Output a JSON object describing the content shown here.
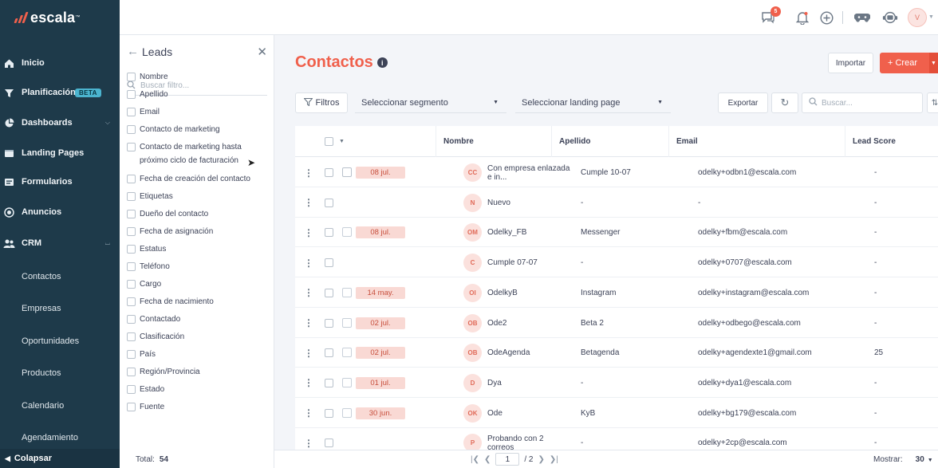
{
  "brand": {
    "name": "escala",
    "accent": "#f0604c",
    "sidebar_bg": "#1e3a4a"
  },
  "sidebar": {
    "items": [
      {
        "label": "Inicio",
        "icon": "home-icon"
      },
      {
        "label": "Planificación",
        "icon": "funnel-icon",
        "badge": "BETA"
      },
      {
        "label": "Dashboards",
        "icon": "pie-chart-icon",
        "chevron": "down"
      },
      {
        "label": "Landing Pages",
        "icon": "browser-icon"
      },
      {
        "label": "Formularios",
        "icon": "form-icon"
      },
      {
        "label": "Anuncios",
        "icon": "target-icon"
      },
      {
        "label": "CRM",
        "icon": "users-icon",
        "chevron": "up"
      }
    ],
    "crm_sub": [
      "Contactos",
      "Empresas",
      "Oportunidades",
      "Productos",
      "Calendario",
      "Agendamiento"
    ],
    "collapse_label": "Colapsar"
  },
  "topbar": {
    "notifications_count": "5",
    "avatar_initial": "V"
  },
  "filter_panel": {
    "title": "Leads",
    "search_placeholder": "Buscar filtro...",
    "fields": [
      "Nombre",
      "Apellido",
      "Email",
      "Contacto de marketing",
      "Contacto de marketing hasta próximo ciclo de facturación",
      "Fecha de creación del contacto",
      "Etiquetas",
      "Dueño del contacto",
      "Fecha de asignación",
      "Estatus",
      "Teléfono",
      "Cargo",
      "Fecha de nacimiento",
      "Contactado",
      "Clasificación",
      "País",
      "Región/Provincia",
      "Estado",
      "Fuente"
    ]
  },
  "main": {
    "title": "Contactos",
    "import_label": "Importar",
    "create_label": "+ Crear",
    "filters_label": "Filtros",
    "segment_placeholder": "Seleccionar segmento",
    "landing_placeholder": "Seleccionar landing page",
    "export_label": "Exportar",
    "search_placeholder": "Buscar..."
  },
  "table": {
    "columns": [
      "Nombre",
      "Apellido",
      "Email",
      "Lead Score"
    ],
    "rows": [
      {
        "date": "08 jul.",
        "initials": "CC",
        "name": "Con empresa enlazada e in...",
        "apellido": "Cumple 10-07",
        "email": "odelky+odbn1@escala.com",
        "score": "-"
      },
      {
        "date": "",
        "initials": "N",
        "name": "Nuevo",
        "apellido": "-",
        "email": "-",
        "score": "-"
      },
      {
        "date": "08 jul.",
        "initials": "OM",
        "name": "Odelky_FB",
        "apellido": "Messenger",
        "email": "odelky+fbm@escala.com",
        "score": "-"
      },
      {
        "date": "",
        "initials": "C",
        "name": "Cumple 07-07",
        "apellido": "-",
        "email": "odelky+0707@escala.com",
        "score": "-"
      },
      {
        "date": "14 may.",
        "initials": "OI",
        "name": "OdelkyB",
        "apellido": "Instagram",
        "email": "odelky+instagram@escala.com",
        "score": "-"
      },
      {
        "date": "02 jul.",
        "initials": "OB",
        "name": "Ode2",
        "apellido": "Beta 2",
        "email": "odelky+odbego@escala.com",
        "score": "-"
      },
      {
        "date": "02 jul.",
        "initials": "OB",
        "name": "OdeAgenda",
        "apellido": "Betagenda",
        "email": "odelky+agendexte1@gmail.com",
        "score": "25"
      },
      {
        "date": "01 jul.",
        "initials": "D",
        "name": "Dya",
        "apellido": "-",
        "email": "odelky+dya1@escala.com",
        "score": "-"
      },
      {
        "date": "30 jun.",
        "initials": "OK",
        "name": "Ode",
        "apellido": "KyB",
        "email": "odelky+bg179@escala.com",
        "score": "-"
      },
      {
        "date": "",
        "initials": "P",
        "name": "Probando con 2 correos",
        "apellido": "-",
        "email": "odelky+2cp@escala.com",
        "score": "-"
      }
    ]
  },
  "footer": {
    "total_label": "Total:",
    "total_value": "54",
    "page": "1",
    "pages": "/ 2",
    "show_label": "Mostrar:",
    "show_value": "30"
  }
}
